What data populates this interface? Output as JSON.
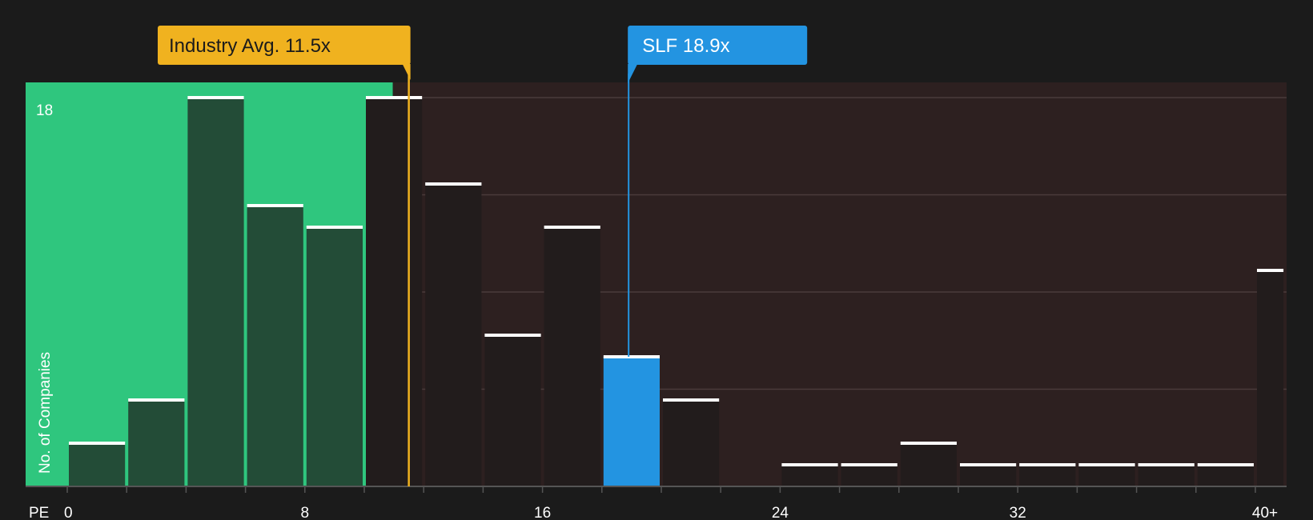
{
  "chart_data": {
    "type": "bar",
    "xlabel": "PE",
    "ylabel": "No. of Companies",
    "x_tick_labels": [
      "0",
      "8",
      "16",
      "24",
      "32",
      "40+"
    ],
    "x_tick_values": [
      0,
      8,
      16,
      24,
      32,
      40
    ],
    "y_tick_label": "18",
    "ylim": [
      0,
      18
    ],
    "bin_width": 2,
    "bins": [
      {
        "x0": 0,
        "x1": 2,
        "value": 2
      },
      {
        "x0": 2,
        "x1": 4,
        "value": 4
      },
      {
        "x0": 4,
        "x1": 6,
        "value": 18
      },
      {
        "x0": 6,
        "x1": 8,
        "value": 13
      },
      {
        "x0": 8,
        "x1": 10,
        "value": 12
      },
      {
        "x0": 10,
        "x1": 12,
        "value": 18
      },
      {
        "x0": 12,
        "x1": 14,
        "value": 14
      },
      {
        "x0": 14,
        "x1": 16,
        "value": 7
      },
      {
        "x0": 16,
        "x1": 18,
        "value": 12
      },
      {
        "x0": 18,
        "x1": 20,
        "value": 6
      },
      {
        "x0": 20,
        "x1": 22,
        "value": 4
      },
      {
        "x0": 24,
        "x1": 26,
        "value": 1
      },
      {
        "x0": 26,
        "x1": 28,
        "value": 1
      },
      {
        "x0": 28,
        "x1": 30,
        "value": 2
      },
      {
        "x0": 30,
        "x1": 32,
        "value": 1
      },
      {
        "x0": 32,
        "x1": 34,
        "value": 1
      },
      {
        "x0": 34,
        "x1": 36,
        "value": 1
      },
      {
        "x0": 36,
        "x1": 38,
        "value": 1
      },
      {
        "x0": 38,
        "x1": 40,
        "value": 1
      },
      {
        "x0": 40,
        "x1": 41,
        "value": 10
      }
    ],
    "highlight_bin_index": 9,
    "industry_avg": {
      "label": "Industry Avg.",
      "value_text": "11.5x",
      "value": 11.5
    },
    "company": {
      "label": "SLF",
      "value_text": "18.9x",
      "value": 18.9
    },
    "colors": {
      "background": "#1b1b1b",
      "below_avg_region": "#2fc67e",
      "above_avg_region": "#2d2020",
      "bar_on_green": "#234c37",
      "bar_on_dark": "#221c1c",
      "highlight_bar": "#2394e1",
      "bar_cap": "#ffffff",
      "industry_callout": "#f0b21f",
      "company_callout": "#2394e1"
    }
  }
}
